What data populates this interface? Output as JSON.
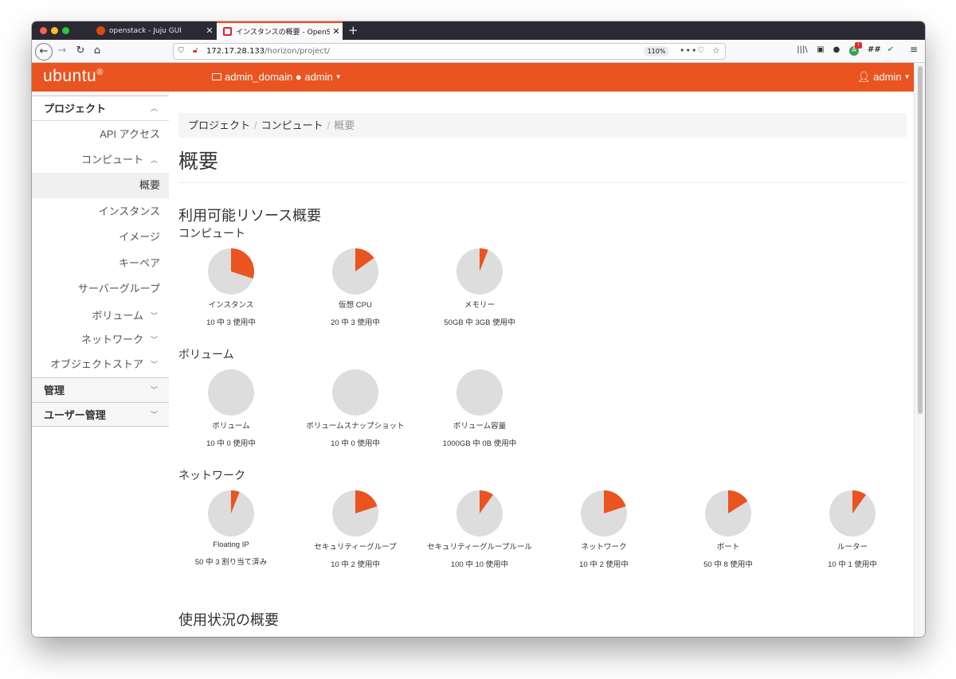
{
  "browser": {
    "tabs": [
      {
        "title": "openstack - Juju GUI",
        "active": false
      },
      {
        "title": "インスタンスの概要 - OpenStack",
        "active": true
      }
    ],
    "url_host": "172.17.28.133",
    "url_path": "/horizon/project/",
    "zoom": "110%"
  },
  "header": {
    "brand": "ubuntu",
    "brand_mark": "®",
    "project": "admin_domain ● admin",
    "user": "admin"
  },
  "sidebar": {
    "project_section": "プロジェクト",
    "api_access": "API アクセス",
    "compute_group": "コンピュート",
    "items": [
      {
        "label": "概要",
        "active": true
      },
      {
        "label": "インスタンス",
        "active": false
      },
      {
        "label": "イメージ",
        "active": false
      },
      {
        "label": "キーペア",
        "active": false
      },
      {
        "label": "サーバーグループ",
        "active": false
      }
    ],
    "volume_group": "ボリューム",
    "network_group": "ネットワーク",
    "object_store_group": "オブジェクトストア",
    "admin_section": "管理",
    "identity_section": "ユーザー管理"
  },
  "main": {
    "breadcrumb": [
      "プロジェクト",
      "コンピュート",
      "概要"
    ],
    "title": "概要",
    "limits_heading": "利用可能リソース概要",
    "compute_heading": "コンピュート",
    "volume_heading": "ボリューム",
    "network_heading": "ネットワーク",
    "usage_heading": "使用状況の概要"
  },
  "colors": {
    "accent": "#e95420",
    "pie_bg": "#dddddd"
  },
  "chart_data": [
    {
      "type": "pie",
      "section": "compute",
      "items": [
        {
          "label": "インスタンス",
          "used": 3,
          "total": 10,
          "text": "10 中 3 使用中"
        },
        {
          "label": "仮想 CPU",
          "used": 3,
          "total": 20,
          "text": "20 中 3 使用中"
        },
        {
          "label": "メモリー",
          "used": 3,
          "total": 50,
          "text": "50GB 中 3GB 使用中"
        }
      ]
    },
    {
      "type": "pie",
      "section": "volume",
      "items": [
        {
          "label": "ボリューム",
          "used": 0,
          "total": 10,
          "text": "10 中 0 使用中"
        },
        {
          "label": "ボリュームスナップショット",
          "used": 0,
          "total": 10,
          "text": "10 中 0 使用中"
        },
        {
          "label": "ボリューム容量",
          "used": 0,
          "total": 1000,
          "text": "1000GB 中 0B 使用中"
        }
      ]
    },
    {
      "type": "pie",
      "section": "network",
      "items": [
        {
          "label": "Floating IP",
          "used": 3,
          "total": 50,
          "text": "50 中 3 割り当て済み"
        },
        {
          "label": "セキュリティーグループ",
          "used": 2,
          "total": 10,
          "text": "10 中 2 使用中"
        },
        {
          "label": "セキュリティーグループルール",
          "used": 10,
          "total": 100,
          "text": "100 中 10 使用中"
        },
        {
          "label": "ネットワーク",
          "used": 2,
          "total": 10,
          "text": "10 中 2 使用中"
        },
        {
          "label": "ポート",
          "used": 8,
          "total": 50,
          "text": "50 中 8 使用中"
        },
        {
          "label": "ルーター",
          "used": 1,
          "total": 10,
          "text": "10 中 1 使用中"
        }
      ]
    }
  ]
}
